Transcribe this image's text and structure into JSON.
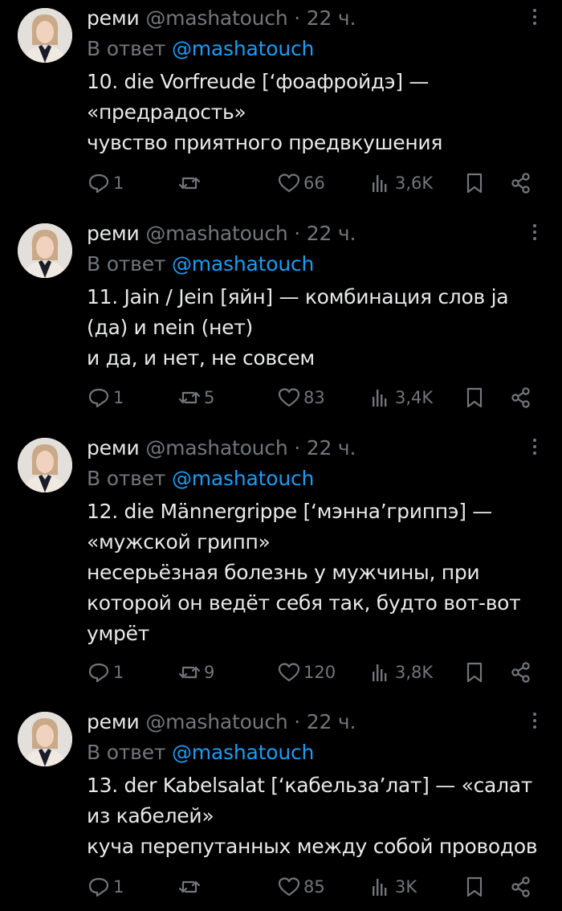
{
  "colors": {
    "background": "#000000",
    "text": "#e7e9ea",
    "muted": "#71767b",
    "link": "#1d9bf0"
  },
  "tweets": [
    {
      "name": "реми",
      "handle": "@mashatouch",
      "time": "· 22 ч.",
      "reply_prefix": "В ответ",
      "reply_to": "@mashatouch",
      "lines": [
        "10. die Vorfreude [‘фоафройдэ] —",
        "«предрадость»",
        "чувство приятного предвкушения"
      ],
      "replies": "1",
      "reposts": "",
      "likes": "66",
      "views": "3,6K"
    },
    {
      "name": "реми",
      "handle": "@mashatouch",
      "time": "· 22 ч.",
      "reply_prefix": "В ответ",
      "reply_to": "@mashatouch",
      "lines": [
        "11. Jain / Jein [яйн] — комбинация слов ja",
        "(да) и nein (нет)",
        "и да, и нет, не совсем"
      ],
      "replies": "1",
      "reposts": "5",
      "likes": "83",
      "views": "3,4K"
    },
    {
      "name": "реми",
      "handle": "@mashatouch",
      "time": "· 22 ч.",
      "reply_prefix": "В ответ",
      "reply_to": "@mashatouch",
      "lines": [
        "12. die Männergrippe [‘мэнна’гриппэ] —",
        "«мужской грипп»",
        "несерьёзная болезнь у мужчины, при",
        "которой он ведёт себя так, будто вот-вот",
        "умрёт"
      ],
      "replies": "1",
      "reposts": "9",
      "likes": "120",
      "views": "3,8K"
    },
    {
      "name": "реми",
      "handle": "@mashatouch",
      "time": "· 22 ч.",
      "reply_prefix": "В ответ",
      "reply_to": "@mashatouch",
      "lines": [
        "13. der Kabelsalat [‘кабельза’лат] — «салат",
        "из кабелей»",
        "куча перепутанных между собой проводов"
      ],
      "replies": "1",
      "reposts": "",
      "likes": "85",
      "views": "3K"
    }
  ],
  "icons": [
    "avatar",
    "more-icon",
    "reply-icon",
    "repost-icon",
    "like-icon",
    "views-icon",
    "bookmark-icon",
    "share-icon"
  ]
}
